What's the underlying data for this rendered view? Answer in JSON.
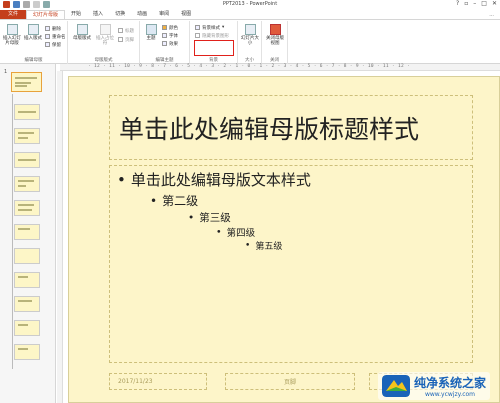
{
  "window": {
    "title": "PPT2013 - PowerPoint"
  },
  "qat": {
    "icons": [
      "powerpoint-logo-icon",
      "save-icon",
      "undo-icon",
      "redo-icon",
      "start-from-beginning-icon",
      "customize-qat-icon"
    ]
  },
  "tabs": [
    {
      "label": "文件"
    },
    {
      "label": "幻灯片母版"
    },
    {
      "label": "开始"
    },
    {
      "label": "插入"
    },
    {
      "label": "切换"
    },
    {
      "label": "动画"
    },
    {
      "label": "审阅"
    },
    {
      "label": "视图"
    }
  ],
  "user": "...",
  "ribbon": {
    "edit_master": {
      "insert_slide_master": "插入幻灯片母版",
      "insert_layout": "插入版式",
      "rename": "重命名",
      "preserve": "保留",
      "delete": "删除",
      "label": "编辑母版"
    },
    "master_layout": {
      "master_layout": "母版版式",
      "title": "标题",
      "footer": "页脚",
      "insert_placeholder": "插入占位符",
      "label": "母版版式"
    },
    "edit_theme": {
      "themes": "主题",
      "colors": "颜色",
      "fonts": "字体",
      "effects": "效果",
      "label": "编辑主题"
    },
    "background": {
      "background_styles": "背景样式",
      "hide_background_graphics": "隐藏背景图形",
      "label": "背景"
    },
    "size": {
      "slide_size": "幻灯片大小",
      "label": "大小"
    },
    "close": {
      "close_master_view": "关闭母版视图",
      "label": "关闭"
    }
  },
  "ruler": {
    "text": "· 12 · 11 · 10 · 9 · 8 · 7 · 6 · 5 · 4 · 3 · 2 · 1 · 0 · 1 · 2 · 3 · 4 · 5 · 6 · 7 · 8 · 9 · 10 · 11 · 12 ·"
  },
  "thumbnails": {
    "first_number": "1"
  },
  "slide": {
    "title": "单击此处编辑母版标题样式",
    "levels": [
      "单击此处编辑母版文本样式",
      "第二级",
      "第三级",
      "第四级",
      "第五级"
    ],
    "bullet": "•",
    "date": "2017/11/23",
    "footer": "页脚"
  },
  "watermark": {
    "brand": "纯净系统之家",
    "url": "www.ycwjzy.com"
  },
  "colors": {
    "file_tab": "#c43e1c",
    "slide_bg": "#fdf5c9",
    "highlight": "#e0211b"
  }
}
